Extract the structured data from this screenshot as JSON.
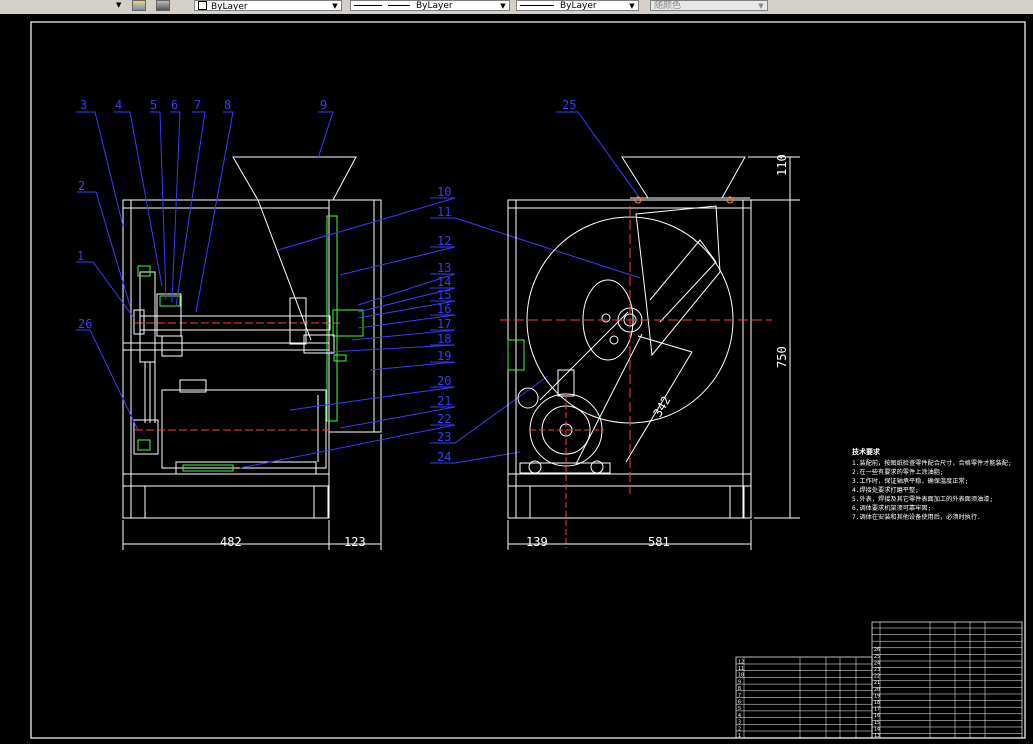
{
  "toolbar": {
    "layer_color": "ByLayer",
    "linetype": "ByLayer",
    "lineweight": "ByLayer",
    "plot_style": "随颜色"
  },
  "balloons": [
    "1",
    "2",
    "3",
    "4",
    "5",
    "6",
    "7",
    "8",
    "9",
    "10",
    "11",
    "12",
    "13",
    "14",
    "15",
    "16",
    "17",
    "18",
    "19",
    "20",
    "21",
    "22",
    "23",
    "24",
    "25",
    "26"
  ],
  "dimensions": {
    "d482": "482",
    "d123": "123",
    "d139": "139",
    "d581": "581",
    "d110": "110",
    "d750": "750",
    "d342": "342"
  },
  "notes": {
    "title": "技术要求",
    "lines": [
      "1.装配前，按图纸检查零件配合尺寸，合格零件才能装配;",
      "2.在一些有要求的零件上涂油脂;",
      "3.工作时，保证轴承平稳，确保温度正常;",
      "4.焊接处要求打磨平整;",
      "5.外表，焊接及其它零件表面加工的外表面须油漆;",
      "6.调体要求机架须可靠牢固;",
      "7.调体在安装和其他设备使用后，必须时执行."
    ]
  },
  "title_block": {
    "row_numbers": [
      "1",
      "2",
      "3",
      "4",
      "5",
      "6",
      "7",
      "8",
      "9",
      "10",
      "11",
      "12",
      "13",
      "14",
      "15",
      "16",
      "17",
      "18",
      "19",
      "20",
      "21",
      "22",
      "23",
      "24",
      "25",
      "26"
    ]
  }
}
